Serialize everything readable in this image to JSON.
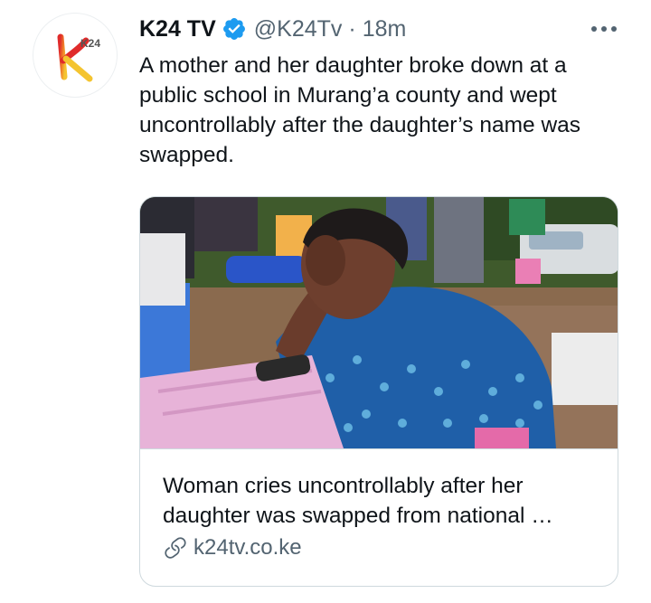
{
  "tweet": {
    "author": {
      "avatar_text": "K24",
      "display_name": "K24 TV",
      "handle": "@K24Tv",
      "separator": "·",
      "timestamp": "18m"
    },
    "text": "A mother and her daughter broke down at a public school in Murang’a county and wept uncontrollably after the daughter’s name was swapped.",
    "card": {
      "title": "Woman cries uncontrollably after her daughter was swapped from national …",
      "domain": "k24tv.co.ke"
    }
  },
  "icons": {
    "verified": "verified-badge-icon",
    "more": "more-options-icon",
    "link": "link-icon"
  },
  "colors": {
    "primary_text": "#0f1419",
    "secondary_text": "#536471",
    "verified_blue": "#1d9bf0",
    "border": "#cfd9de",
    "brand_orange": "#f0832a",
    "brand_red": "#e02b2b",
    "brand_yellow": "#f4c430"
  }
}
